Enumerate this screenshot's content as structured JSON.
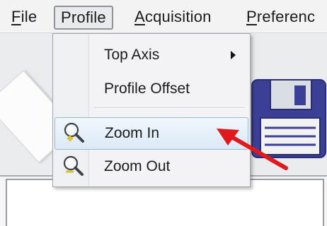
{
  "menubar": {
    "items": [
      {
        "label": "File",
        "mnemonic": "F",
        "rest": "ile"
      },
      {
        "label": "Profile",
        "mnemonic": "",
        "rest": "Profile"
      },
      {
        "label": "Acquisition",
        "mnemonic": "A",
        "rest": "cquisition"
      },
      {
        "label": "Preferences",
        "mnemonic": "P",
        "rest": "referenc"
      }
    ]
  },
  "profile_menu": {
    "items": [
      {
        "label": "Top Axis",
        "has_submenu": true
      },
      {
        "label": "Profile Offset"
      },
      {
        "label": "Zoom In",
        "icon": "zoom-in-icon",
        "highlighted": true
      },
      {
        "label": "Zoom Out",
        "icon": "zoom-out-icon"
      }
    ]
  },
  "colors": {
    "highlight": "#dbe9f6",
    "arrow": "#e0191c",
    "floppy": "#3a3f93"
  }
}
